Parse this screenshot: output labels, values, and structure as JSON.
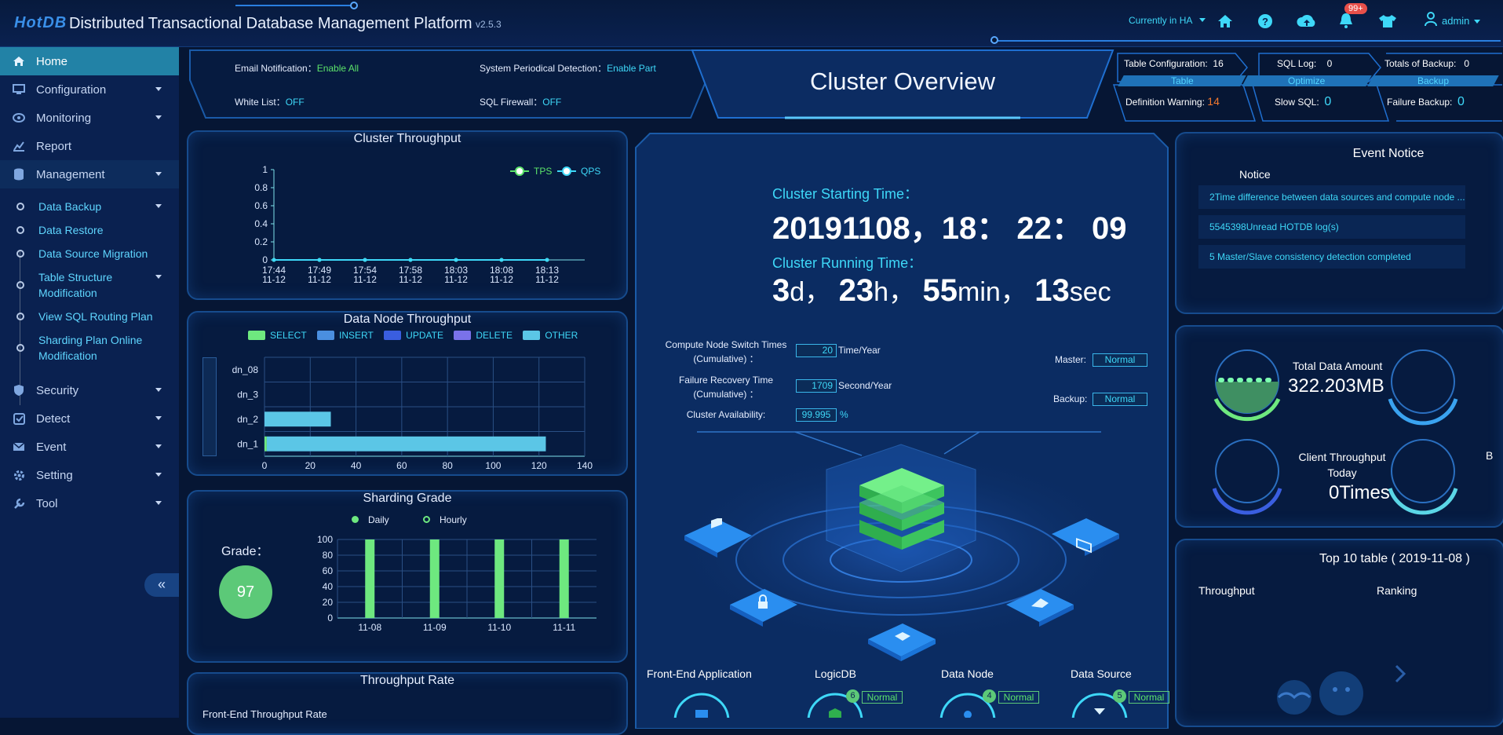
{
  "header": {
    "logo": "HotDB",
    "title": "Distributed Transactional Database Management Platform",
    "version": "v2.5.3",
    "ha_status": "Currently in HA",
    "notification_badge": "99+",
    "user": "admin",
    "icons": [
      "home-icon",
      "help-icon",
      "cloud-upload-icon",
      "bell-icon",
      "shirt-icon",
      "user-icon"
    ]
  },
  "sidebar": {
    "items": [
      {
        "label": "Home",
        "icon": "home-icon"
      },
      {
        "label": "Configuration",
        "icon": "monitor-icon"
      },
      {
        "label": "Monitoring",
        "icon": "eye-icon"
      },
      {
        "label": "Report",
        "icon": "chart-icon"
      },
      {
        "label": "Management",
        "icon": "database-icon"
      },
      {
        "label": "Security",
        "icon": "shield-icon"
      },
      {
        "label": "Detect",
        "icon": "check-square-icon"
      },
      {
        "label": "Event",
        "icon": "mail-icon"
      },
      {
        "label": "Setting",
        "icon": "gear-icon"
      },
      {
        "label": "Tool",
        "icon": "wrench-icon"
      }
    ],
    "subitems": [
      "Data Backup",
      "Data Restore",
      "Data Source Migration",
      "Table Structure Modification",
      "View SQL Routing Plan",
      "Sharding Plan Online Modification"
    ],
    "collapse": "«"
  },
  "status": {
    "email_label": "Email Notification：",
    "email_value": "Enable All",
    "periodical_label": "System Periodical Detection：",
    "periodical_value": "Enable Part",
    "whitelist_label": "White List：",
    "whitelist_value": "OFF",
    "firewall_label": "SQL Firewall：",
    "firewall_value": "OFF"
  },
  "overview_title": "Cluster Overview",
  "stats": {
    "table_config_label": "Table Configuration:",
    "table_config_value": "16",
    "table_tag": "Table",
    "def_warning_label": "Definition Warning:",
    "def_warning_value": "14",
    "sql_log_label": "SQL Log:",
    "sql_log_value": "0",
    "optimize_tag": "Optimize",
    "slow_sql_label": "Slow SQL:",
    "slow_sql_value": "0",
    "backup_total_label": "Totals of Backup:",
    "backup_total_value": "0",
    "backup_tag": "Backup",
    "failure_backup_label": "Failure Backup:",
    "failure_backup_value": "0"
  },
  "throughput": {
    "title": "Cluster Throughput",
    "legend": [
      "TPS",
      "QPS"
    ],
    "chart_data": {
      "type": "line",
      "x": [
        "17:44 11-12",
        "17:49 11-12",
        "17:54 11-12",
        "17:58 11-12",
        "18:03 11-12",
        "18:08 11-12",
        "18:13 11-12"
      ],
      "series": [
        {
          "name": "TPS",
          "values": [
            0,
            0,
            0,
            0,
            0,
            0,
            0
          ]
        },
        {
          "name": "QPS",
          "values": [
            0,
            0,
            0,
            0,
            0,
            0,
            0
          ]
        }
      ],
      "ylim": [
        0,
        1
      ],
      "yticks": [
        "0",
        "0.2",
        "0.4",
        "0.6",
        "0.8",
        "1"
      ]
    }
  },
  "node_throughput": {
    "title": "Data Node Throughput",
    "legend": [
      "SELECT",
      "INSERT",
      "UPDATE",
      "DELETE",
      "OTHER"
    ],
    "colors": [
      "#6ee87f",
      "#4a8fe0",
      "#3a5ee0",
      "#7a72ea",
      "#5bc6e6"
    ],
    "chart_data": {
      "type": "bar",
      "categories": [
        "dn_08",
        "dn_3",
        "dn_2",
        "dn_1"
      ],
      "series": [
        {
          "name": "SELECT",
          "values": [
            0,
            0,
            0,
            1
          ]
        },
        {
          "name": "INSERT",
          "values": [
            0,
            0,
            0,
            0
          ]
        },
        {
          "name": "UPDATE",
          "values": [
            0,
            0,
            0,
            0
          ]
        },
        {
          "name": "DELETE",
          "values": [
            0,
            0,
            0,
            0
          ]
        },
        {
          "name": "OTHER",
          "values": [
            0,
            0,
            29,
            122
          ]
        }
      ],
      "xlim": [
        0,
        140
      ],
      "xticks": [
        "0",
        "20",
        "40",
        "60",
        "80",
        "100",
        "120",
        "140"
      ]
    }
  },
  "sharding": {
    "title": "Sharding Grade",
    "legend": [
      "Daily",
      "Hourly"
    ],
    "grade_label": "Grade：",
    "grade_value": "97",
    "chart_data": {
      "type": "bar",
      "categories": [
        "11-08",
        "11-09",
        "11-10",
        "11-11"
      ],
      "values": [
        100,
        100,
        100,
        100
      ],
      "ylim": [
        0,
        100
      ],
      "yticks": [
        "0",
        "20",
        "40",
        "60",
        "80",
        "100"
      ]
    }
  },
  "throughput_rate": {
    "title": "Throughput Rate",
    "sub": "Front-End Throughput Rate"
  },
  "cluster": {
    "start_label": "Cluster Starting Time：",
    "start_value": "20191108，18： 22： 09",
    "running_label": "Cluster Running Time：",
    "run_days": "3",
    "unit_d": "d，",
    "run_hours": "23",
    "unit_h": "h，",
    "run_min": "55",
    "unit_min": "min，",
    "run_sec": "13",
    "unit_sec": "sec",
    "switch_label": "Compute Node Switch Times (Cumulative) ：",
    "switch_value": "20",
    "switch_unit": "Time/Year",
    "recovery_label": "Failure Recovery Time (Cumulative) ：",
    "recovery_value": "1709",
    "recovery_unit": "Second/Year",
    "availability_label": "Cluster Availability:",
    "availability_value": "99.995",
    "availability_unit": "%",
    "master_label": "Master:",
    "master_value": "Normal",
    "backup_label": "Backup:",
    "backup_value": "Normal",
    "bottom": [
      {
        "label": "Front-End Application"
      },
      {
        "label": "LogicDB",
        "count": "6",
        "status": "Normal"
      },
      {
        "label": "Data Node",
        "count": "4",
        "status": "Normal"
      },
      {
        "label": "Data Source",
        "count": "5",
        "status": "Normal"
      }
    ]
  },
  "event": {
    "title": "Event Notice",
    "subtitle": "Notice",
    "items": [
      "2Time difference between data sources and compute node ...",
      "5545398Unread HOTDB log(s)",
      "5 Master/Slave consistency detection completed"
    ]
  },
  "data_amount": {
    "label": "Total Data Amount",
    "value": "322.203MB",
    "client_label": "Client Throughput Today",
    "client_value": "0Times",
    "clipped": "B"
  },
  "top10": {
    "title": "Top 10 table ( 2019-11-08 )",
    "col1": "Throughput",
    "col2": "Ranking"
  }
}
